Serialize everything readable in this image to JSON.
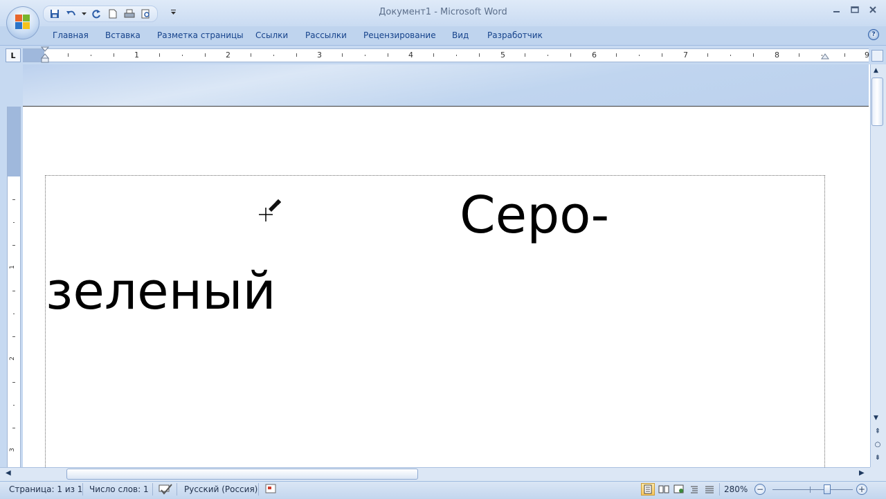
{
  "window": {
    "title": "Документ1 - Microsoft Word",
    "quick_access": [
      "save-icon",
      "undo-icon",
      "redo-icon",
      "new-document-icon",
      "print-icon",
      "print-preview-icon"
    ],
    "controls": [
      "minimize-icon",
      "maximize-icon",
      "close-icon"
    ]
  },
  "ribbon": {
    "tabs": [
      "Главная",
      "Вставка",
      "Разметка страницы",
      "Ссылки",
      "Рассылки",
      "Рецензирование",
      "Вид",
      "Разработчик"
    ]
  },
  "ruler": {
    "tab_selector": "L",
    "horizontal_numbers": [
      "1",
      "2",
      "3",
      "4",
      "5",
      "6",
      "7",
      "8",
      "9"
    ],
    "vertical_numbers": [
      "1",
      "2",
      "3"
    ]
  },
  "document": {
    "line1": "Серо-",
    "line2": "зеленый"
  },
  "status_bar": {
    "page": "Страница: 1 из 1",
    "words": "Число слов: 1",
    "language": "Русский (Россия)",
    "zoom": "280%",
    "zoom_percent": 280
  },
  "colors": {
    "accent": "#15428b",
    "ribbon": "#bfd4ee",
    "status_bar": "#c3d6ee"
  }
}
